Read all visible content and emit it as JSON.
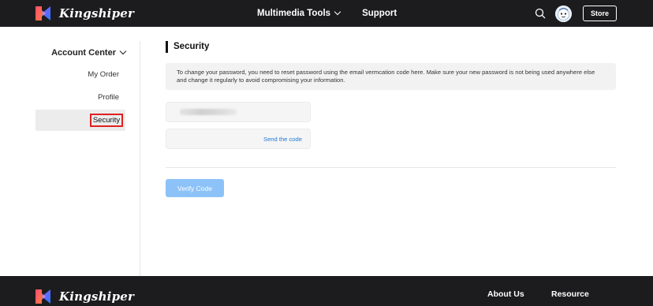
{
  "header": {
    "brand": "Kingshiper",
    "nav": [
      "Multimedia Tools",
      "Support"
    ],
    "store_label": "Store"
  },
  "sidebar": {
    "title": "Account Center",
    "items": [
      {
        "label": "My Order"
      },
      {
        "label": "Profile"
      },
      {
        "label": "Security",
        "active": true
      }
    ]
  },
  "main": {
    "section_title": "Security",
    "notice": "To change your password, you need to reset password using the email vermcation code here. Make sure your new password is not being used anywhere else and change it regularly to avoid compromising your information.",
    "send_code_label": "Send the code",
    "verify_button_label": "Verify Code"
  },
  "footer": {
    "brand": "Kingshiper",
    "links": [
      "About Us",
      "Resource"
    ]
  },
  "colors": {
    "dark_bar": "#1c1c1e",
    "brand_gradient_start": "#ff4d6d",
    "brand_gradient_end": "#2f7bff",
    "link_blue": "#1e78d6",
    "button_disabled_blue": "#8cc2f7",
    "highlight_red": "#e02020"
  }
}
